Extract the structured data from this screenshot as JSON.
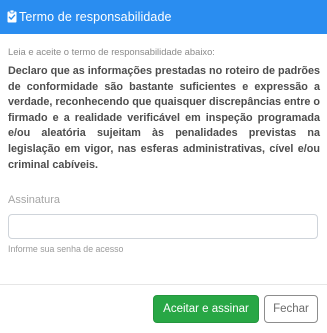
{
  "header": {
    "title": "Termo de responsabilidade",
    "icon": "clipboard-check-icon",
    "background": "#2a8df0"
  },
  "body": {
    "hint": "Leia e aceite o termo de responsabilidade abaixo:",
    "declaration": "Declaro que as informações prestadas no roteiro de padrões de conformidade são bastante suficientes e expressão a verdade, reconhecendo que quaisquer discrepâncias entre o firmado e a realidade verificável em inspeção programada e/ou aleatória sujeitam às penalidades previstas na legislação em vigor, nas esferas administrativas, cível e/ou criminal cabíveis."
  },
  "signature": {
    "label": "Assinatura",
    "value": "",
    "placeholder": "",
    "help": "Informe sua senha de acesso"
  },
  "footer": {
    "accept_label": "Aceitar e assinar",
    "accept_color": "#28a745",
    "close_label": "Fechar"
  }
}
